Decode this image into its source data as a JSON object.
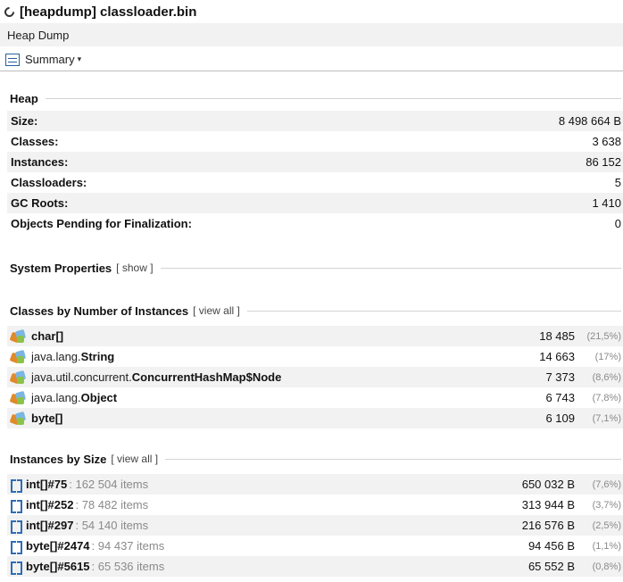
{
  "window": {
    "title": "[heapdump] classloader.bin"
  },
  "tab": {
    "label": "Heap Dump"
  },
  "toolbar": {
    "summary_label": "Summary",
    "icon": "document-icon"
  },
  "heap": {
    "title": "Heap",
    "rows": [
      {
        "label": "Size:",
        "value": "8 498 664 B"
      },
      {
        "label": "Classes:",
        "value": "3 638"
      },
      {
        "label": "Instances:",
        "value": "86 152"
      },
      {
        "label": "Classloaders:",
        "value": "5"
      },
      {
        "label": "GC Roots:",
        "value": "1 410"
      },
      {
        "label": "Objects Pending for Finalization:",
        "value": "0"
      }
    ]
  },
  "system_properties": {
    "title": "System Properties",
    "link": "[ show ]"
  },
  "classes_by_instances": {
    "title": "Classes by Number of Instances",
    "link": "[ view all ]",
    "rows": [
      {
        "pkg": "",
        "name": "char[]",
        "count": "18 485",
        "pct": "(21,5%)"
      },
      {
        "pkg": "java.lang.",
        "name": "String",
        "count": "14 663",
        "pct": "(17%)"
      },
      {
        "pkg": "java.util.concurrent.",
        "name": "ConcurrentHashMap$Node",
        "count": "7 373",
        "pct": "(8,6%)"
      },
      {
        "pkg": "java.lang.",
        "name": "Object",
        "count": "6 743",
        "pct": "(7,8%)"
      },
      {
        "pkg": "",
        "name": "byte[]",
        "count": "6 109",
        "pct": "(7,1%)"
      }
    ]
  },
  "instances_by_size": {
    "title": "Instances by Size",
    "link": "[ view all ]",
    "rows": [
      {
        "name": "int[]#75",
        "items": ": 162 504 items",
        "size": "650 032 B",
        "pct": "(7,6%)"
      },
      {
        "name": "int[]#252",
        "items": ": 78 482 items",
        "size": "313 944 B",
        "pct": "(3,7%)"
      },
      {
        "name": "int[]#297",
        "items": ": 54 140 items",
        "size": "216 576 B",
        "pct": "(2,5%)"
      },
      {
        "name": "byte[]#2474",
        "items": ": 94 437 items",
        "size": "94 456 B",
        "pct": "(1,1%)"
      },
      {
        "name": "byte[]#5615",
        "items": ": 65 536 items",
        "size": "65 552 B",
        "pct": "(0,8%)"
      }
    ]
  }
}
